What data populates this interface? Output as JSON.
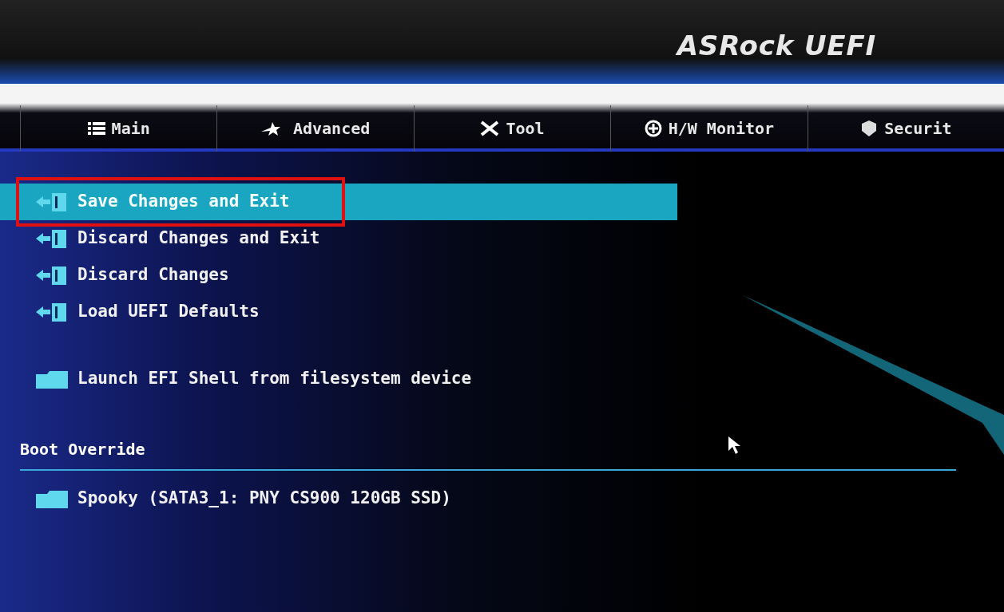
{
  "header": {
    "logo": "ASRock UEFI"
  },
  "tabs": [
    {
      "label": "Main",
      "kind": "list",
      "selected": false
    },
    {
      "label": "Advanced",
      "kind": "star",
      "selected": false
    },
    {
      "label": "Tool",
      "kind": "tools",
      "selected": false
    },
    {
      "label": "H/W Monitor",
      "kind": "monitor",
      "selected": false
    },
    {
      "label": "Securit",
      "kind": "shield",
      "selected": false
    }
  ],
  "menu": [
    {
      "label": "Save Changes and Exit",
      "kind": "exit",
      "selected": true,
      "annotated": true
    },
    {
      "label": "Discard Changes and Exit",
      "kind": "exit",
      "selected": false,
      "annotated": false
    },
    {
      "label": "Discard Changes",
      "kind": "exit",
      "selected": false,
      "annotated": false
    },
    {
      "label": "Load UEFI Defaults",
      "kind": "exit",
      "selected": false,
      "annotated": false
    },
    {
      "label": "Launch EFI Shell from filesystem device",
      "kind": "folder",
      "selected": false,
      "annotated": false
    }
  ],
  "boot_override": {
    "title": "Boot Override",
    "items": [
      {
        "label": "Spooky (SATA3_1: PNY CS900 120GB SSD)",
        "kind": "folder",
        "selected": false
      }
    ]
  }
}
